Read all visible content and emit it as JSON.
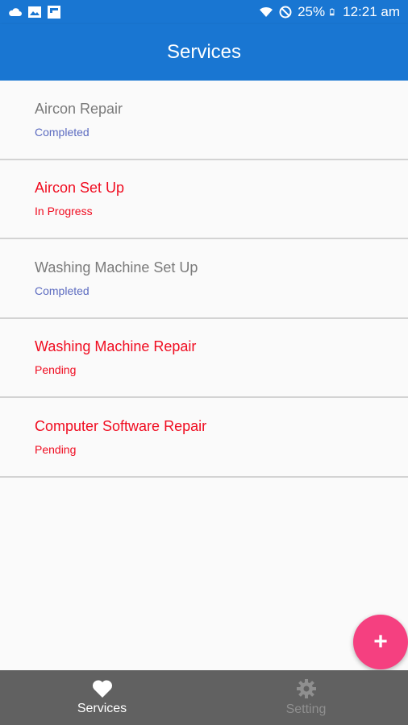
{
  "status_bar": {
    "battery": "25%",
    "time": "12:21 am",
    "left_icons": [
      "cloud-icon",
      "image-icon",
      "flipboard-icon"
    ],
    "right_icons": [
      "wifi-icon",
      "do-not-disturb-icon",
      "battery-icon"
    ]
  },
  "app_bar": {
    "title": "Services"
  },
  "services": [
    {
      "title": "Aircon Repair",
      "status": "Completed"
    },
    {
      "title": "Aircon Set Up",
      "status": "In Progress"
    },
    {
      "title": "Washing Machine Set Up",
      "status": "Completed"
    },
    {
      "title": "Washing Machine Repair",
      "status": "Pending"
    },
    {
      "title": "Computer Software Repair",
      "status": "Pending"
    }
  ],
  "fab": {
    "label": "+"
  },
  "bottom_nav": {
    "items": [
      {
        "label": "Services",
        "icon": "heart-icon"
      },
      {
        "label": "Setting",
        "icon": "gear-icon"
      }
    ]
  },
  "colors": {
    "primary": "#1976d2",
    "accent": "#f54080",
    "alert": "#f00c20",
    "completed": "#5c6bc0",
    "nav_bg": "#616161"
  }
}
